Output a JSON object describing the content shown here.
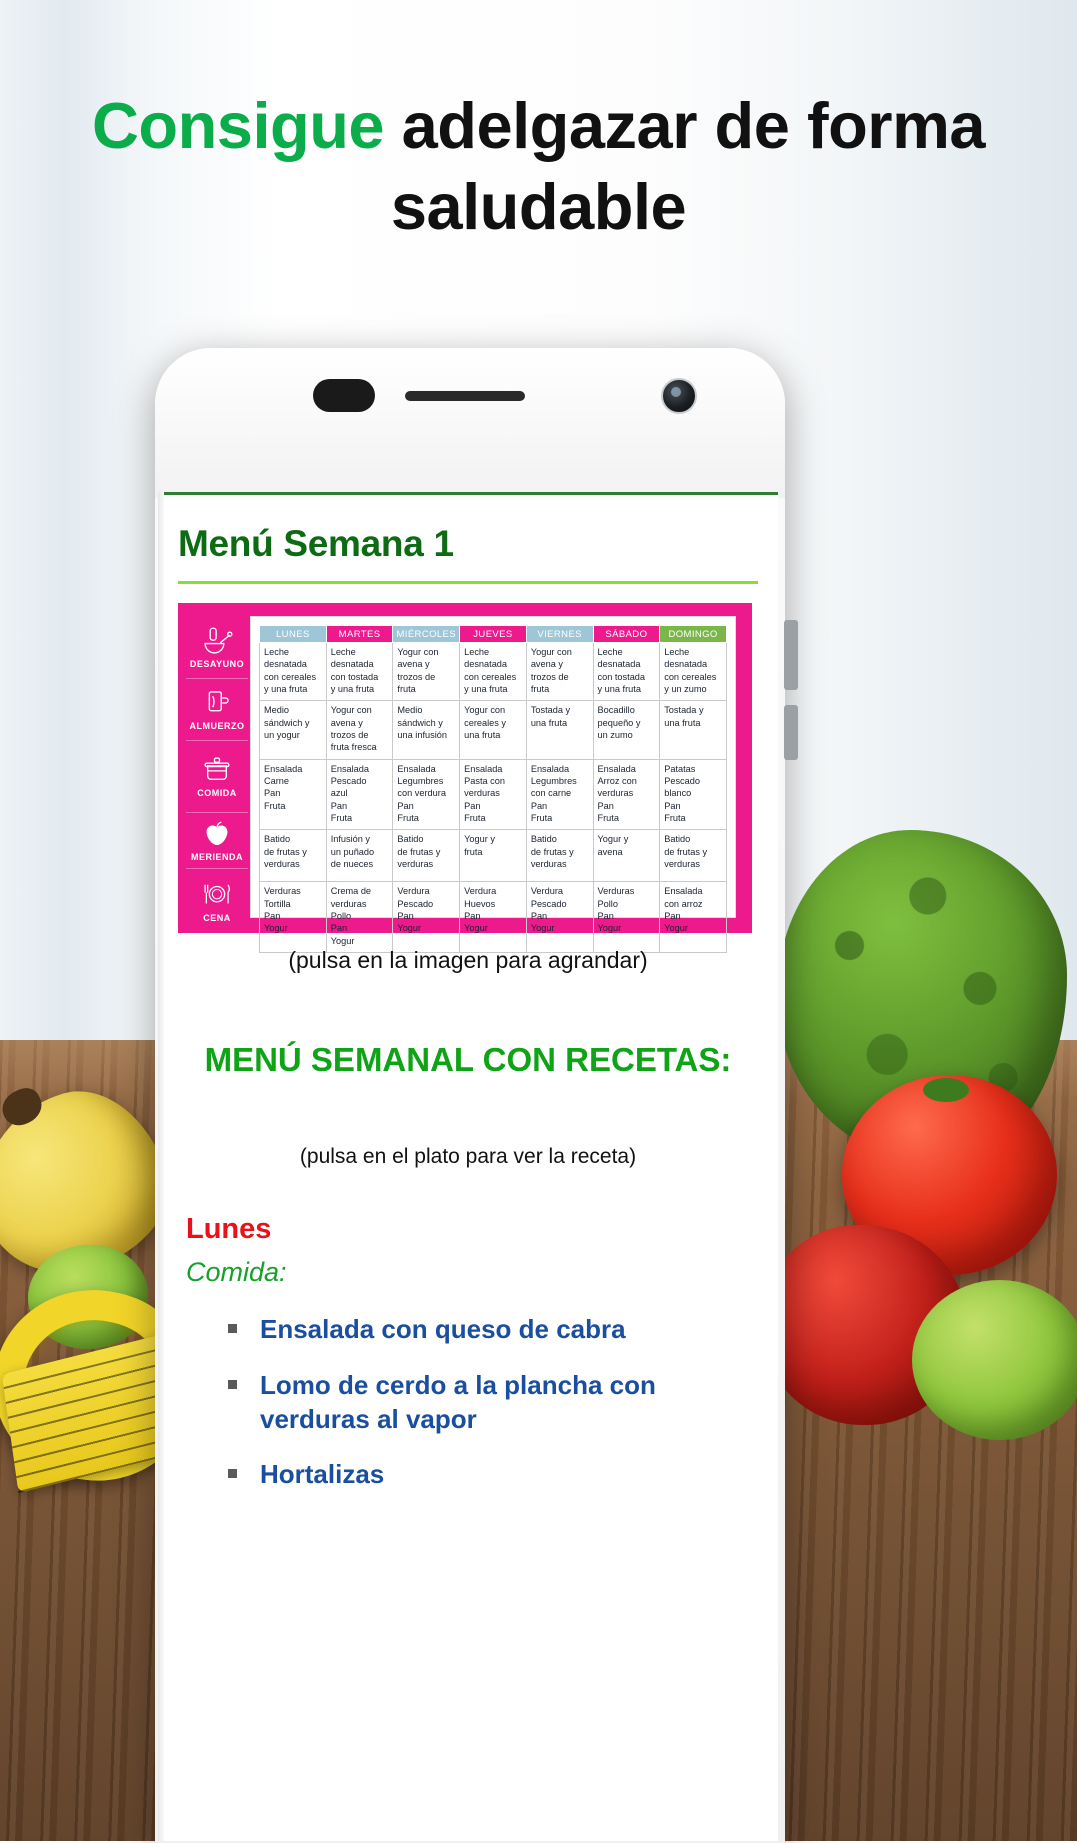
{
  "headline": {
    "green_word": "Consigue",
    "rest": " adelgazar de forma saludable"
  },
  "phone": {
    "icons": {
      "speaker": "speaker-grill-icon",
      "camera": "front-camera-icon",
      "volume": "volume-button"
    }
  },
  "screen": {
    "page_title": "Menú Semana 1",
    "image_caption": "(pulsa en la imagen para agrandar)",
    "recipes_heading": "MENÚ SEMANAL CON RECETAS:",
    "recipes_subcaption": "(pulsa en el plato para ver la receta)",
    "day_name": "Lunes",
    "meal_heading": "Comida:",
    "recipe_links": [
      "Ensalada con queso de cabra",
      "Lomo de cerdo a la plancha con verduras al vapor",
      "Hortalizas"
    ]
  },
  "menu_table": {
    "days": [
      "LUNES",
      "MARTES",
      "MIÉRCOLES",
      "JUEVES",
      "VIERNES",
      "SÁBADO",
      "DOMINGO"
    ],
    "day_header_colors": [
      "blue",
      "pink",
      "blue",
      "pink",
      "blue",
      "pink",
      "green"
    ],
    "meals": [
      {
        "label": "DESAYUNO",
        "icon": "mortar-bowl-icon"
      },
      {
        "label": "ALMUERZO",
        "icon": "sandwich-cup-icon"
      },
      {
        "label": "COMIDA",
        "icon": "pressure-cooker-icon"
      },
      {
        "label": "MERIENDA",
        "icon": "apple-icon"
      },
      {
        "label": "CENA",
        "icon": "plate-cutlery-icon"
      }
    ],
    "rows": [
      {
        "meal": "DESAYUNO",
        "cells": [
          "Leche\ndesnatada\ncon cereales\ny una fruta",
          "Leche\ndesnatada\ncon tostada\ny una fruta",
          "Yogur con\navena y\ntrozos de\nfruta",
          "Leche\ndesnatada\ncon cereales\ny una fruta",
          "Yogur con\navena y\ntrozos de\nfruta",
          "Leche\ndesnatada\ncon tostada\ny una fruta",
          "Leche\ndesnatada\ncon cereales\ny un zumo"
        ]
      },
      {
        "meal": "ALMUERZO",
        "cells": [
          "Medio\nsándwich y\nun yogur",
          "Yogur con\navena y\ntrozos de\nfruta fresca",
          "Medio\nsándwich y\nuna infusión",
          "Yogur con\ncereales y\nuna fruta",
          "Tostada y\nuna fruta",
          "Bocadillo\npequeño y\nun zumo",
          "Tostada y\nuna fruta"
        ]
      },
      {
        "meal": "COMIDA",
        "cells": [
          "Ensalada\nCarne\nPan\nFruta",
          "Ensalada\nPescado\nazul\nPan\nFruta",
          "Ensalada\nLegumbres\ncon verdura\nPan\nFruta",
          "Ensalada\nPasta con\nverduras\nPan\nFruta",
          "Ensalada\nLegumbres\ncon carne\nPan\nFruta",
          "Ensalada\nArroz con\nverduras\nPan\nFruta",
          "Patatas\nPescado\nblanco\nPan\nFruta"
        ]
      },
      {
        "meal": "MERIENDA",
        "cells": [
          "Batido\nde frutas y\nverduras",
          "Infusión y\nun puñado\nde nueces",
          "Batido\nde frutas y\nverduras",
          "Yogur y\nfruta",
          "Batido\nde frutas y\nverduras",
          "Yogur y\navena",
          "Batido\nde frutas y\nverduras"
        ]
      },
      {
        "meal": "CENA",
        "cells": [
          "Verduras\nTortilla\nPan\nYogur",
          "Crema de\nverduras\nPollo\nPan\nYogur",
          "Verdura\nPescado\nPan\nYogur",
          "Verdura\nHuevos\nPan\nYogur",
          "Verdura\nPescado\nPan\nYogur",
          "Verduras\nPollo\nPan\nYogur",
          "Ensalada\ncon arroz\nPan\nYogur"
        ]
      }
    ]
  },
  "colors": {
    "brand_green": "#0aad4a",
    "title_green": "#0d6b14",
    "rule_green": "#82e038",
    "heading_green": "#0fa316",
    "meal_green": "#18a02a",
    "day_red": "#e8121b",
    "link_blue": "#1a4fa0",
    "table_pink": "#ec1a8d",
    "header_blue": "#9ec6d6",
    "header_green": "#7ab648"
  }
}
